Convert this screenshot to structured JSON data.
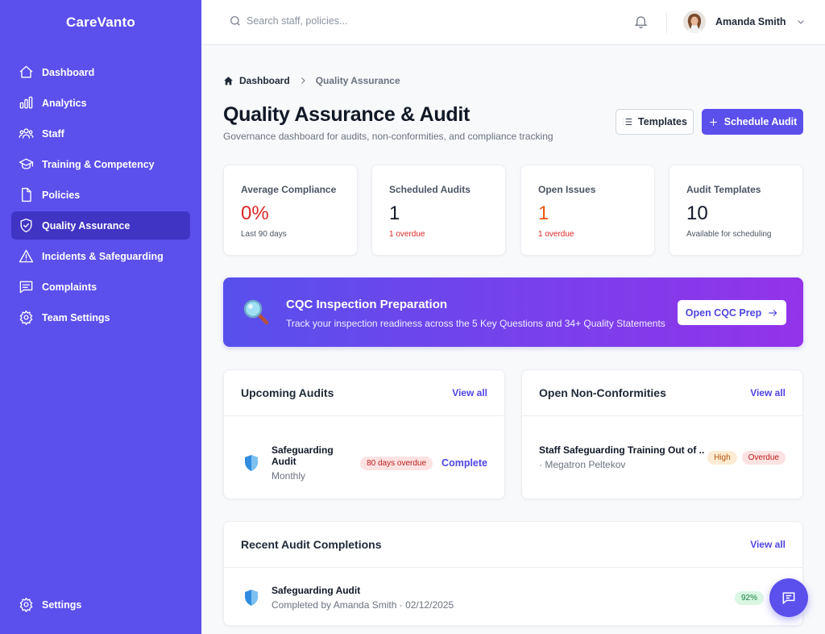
{
  "app": {
    "brand": "CareVanto"
  },
  "sidebar": {
    "items": [
      {
        "label": "Dashboard",
        "icon": "home-icon"
      },
      {
        "label": "Analytics",
        "icon": "bar-chart-icon"
      },
      {
        "label": "Staff",
        "icon": "users-icon"
      },
      {
        "label": "Training & Competency",
        "icon": "graduation-cap-icon"
      },
      {
        "label": "Policies",
        "icon": "document-icon"
      },
      {
        "label": "Quality Assurance",
        "icon": "shield-check-icon",
        "active": true
      },
      {
        "label": "Incidents & Safeguarding",
        "icon": "warning-icon"
      },
      {
        "label": "Complaints",
        "icon": "message-icon"
      },
      {
        "label": "Team Settings",
        "icon": "gear-icon"
      }
    ],
    "settings_label": "Settings"
  },
  "topbar": {
    "search_placeholder": "Search staff, policies...",
    "user_name": "Amanda Smith"
  },
  "breadcrumb": {
    "home": "Dashboard",
    "current": "Quality Assurance"
  },
  "header": {
    "title": "Quality Assurance & Audit",
    "subtitle": "Governance dashboard for audits, non-conformities, and compliance tracking",
    "templates_label": "Templates",
    "schedule_label": "Schedule Audit"
  },
  "stats": [
    {
      "label": "Average Compliance",
      "value": "0%",
      "note": "Last 90 days"
    },
    {
      "label": "Scheduled Audits",
      "value": "1",
      "note": "1 overdue"
    },
    {
      "label": "Open Issues",
      "value": "1",
      "note": "1 overdue"
    },
    {
      "label": "Audit Templates",
      "value": "10",
      "note": "Available for scheduling"
    }
  ],
  "banner": {
    "title": "CQC Inspection Preparation",
    "subtitle": "Track your inspection readiness across the 5 Key Questions and 34+ Quality Statements",
    "button_label": "Open CQC Prep"
  },
  "upcoming": {
    "title": "Upcoming Audits",
    "view_all": "View all",
    "item": {
      "name": "Safeguarding Audit",
      "frequency": "Monthly",
      "badge": "80 days overdue",
      "action": "Complete"
    }
  },
  "nonconf": {
    "title": "Open Non-Conformities",
    "view_all": "View all",
    "item": {
      "name": "Staff Safeguarding Training Out of ...",
      "owner": "· Megatron Peltekov",
      "priority": "High",
      "status": "Overdue"
    }
  },
  "recent": {
    "title": "Recent Audit Completions",
    "view_all": "View all",
    "item": {
      "name": "Safeguarding Audit",
      "meta": "Completed by Amanda Smith · 02/12/2025",
      "score": "92%"
    }
  },
  "colors": {
    "primary": "#5b50ec",
    "sidebar_active": "#3f34c4",
    "danger": "#dc2626",
    "warning": "#ea580c"
  }
}
